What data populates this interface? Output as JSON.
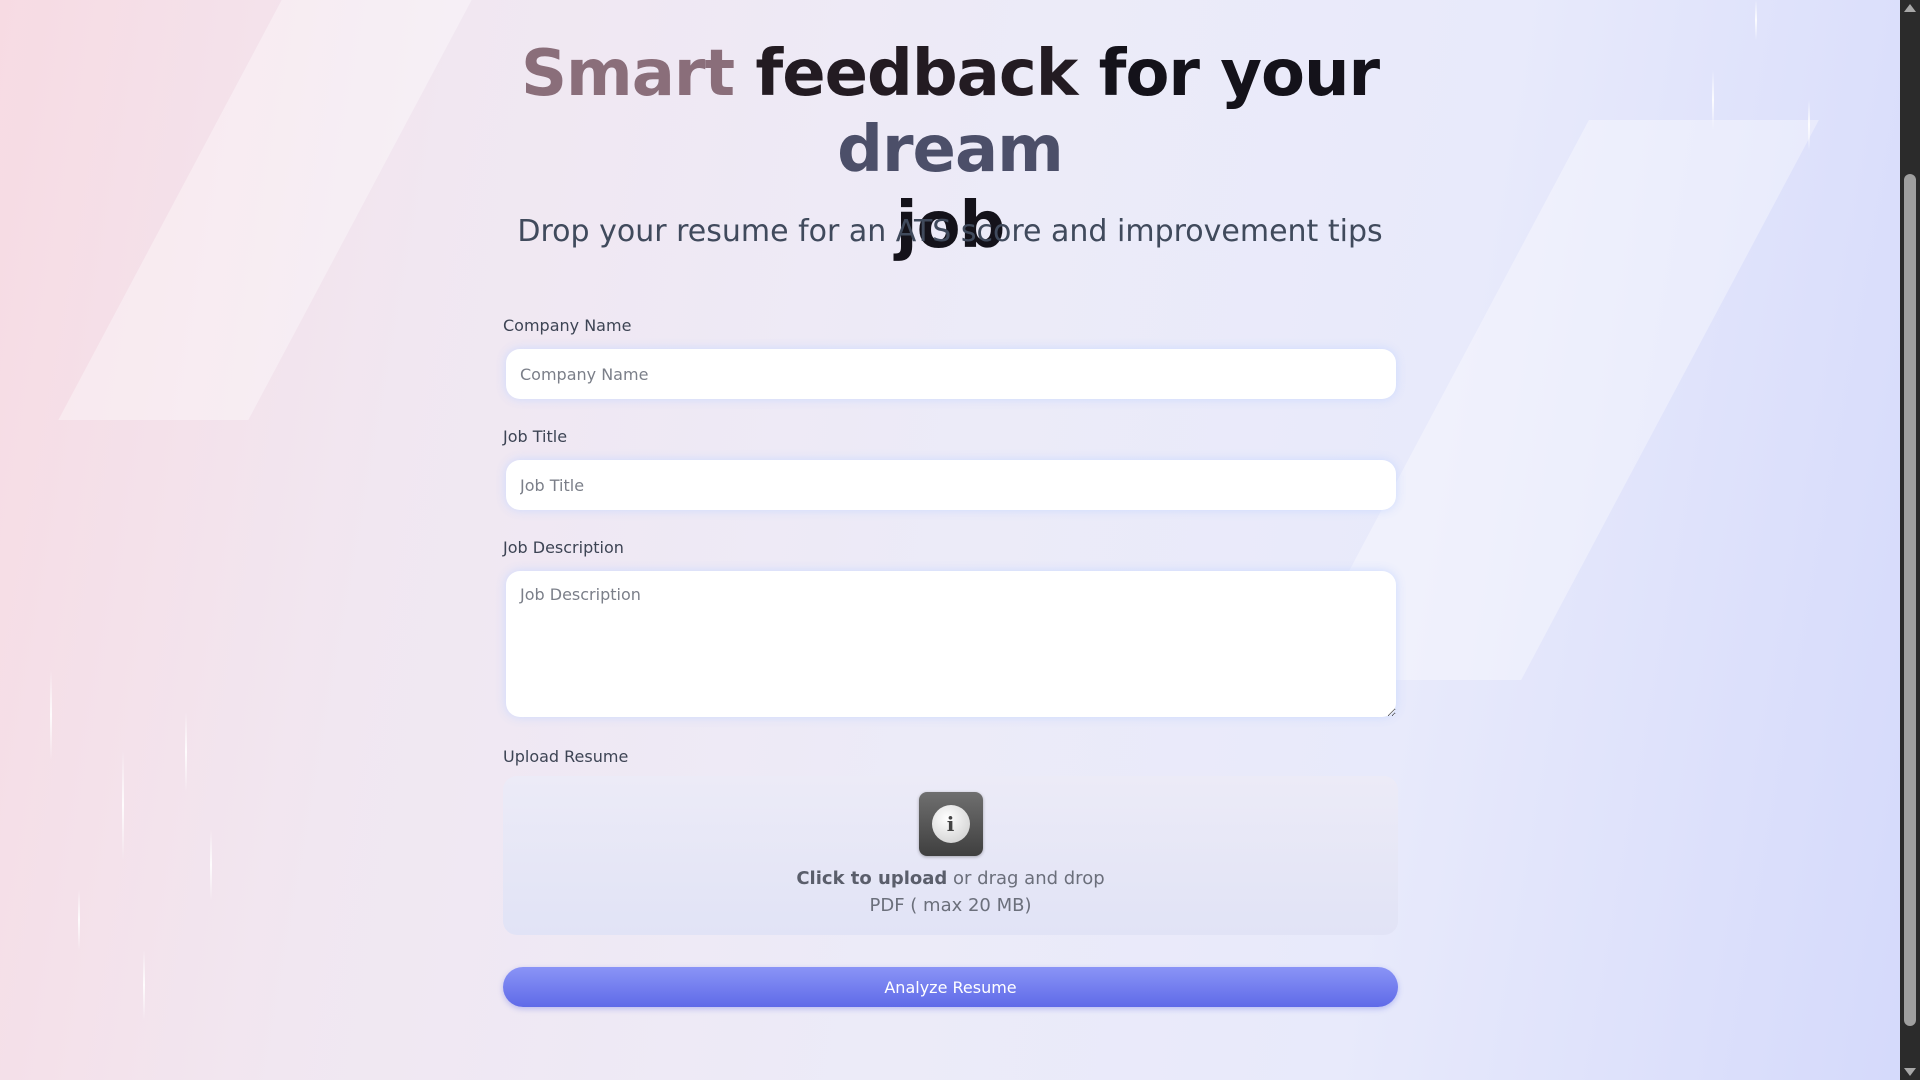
{
  "hero": {
    "title_words": [
      "Smart",
      "feedback",
      "for",
      "your",
      "dream",
      "job"
    ],
    "subtitle": "Drop your resume for an ATS score and improvement tips"
  },
  "form": {
    "company": {
      "label": "Company Name",
      "placeholder": "Company Name"
    },
    "job_title": {
      "label": "Job Title",
      "placeholder": "Job Title"
    },
    "job_description": {
      "label": "Job Description",
      "placeholder": "Job Description"
    },
    "upload": {
      "label": "Upload Resume",
      "click_text": "Click to upload",
      "drag_text": " or drag and drop",
      "hint": "PDF ( max 20 MB)"
    },
    "submit_label": "Analyze Resume"
  },
  "colors": {
    "button_start": "#8a94f6",
    "button_end": "#5f6ae8",
    "title_accent_1": "#8a6e7a",
    "title_accent_2": "#4c4f69"
  },
  "icons": {
    "upload": "info-icon"
  }
}
